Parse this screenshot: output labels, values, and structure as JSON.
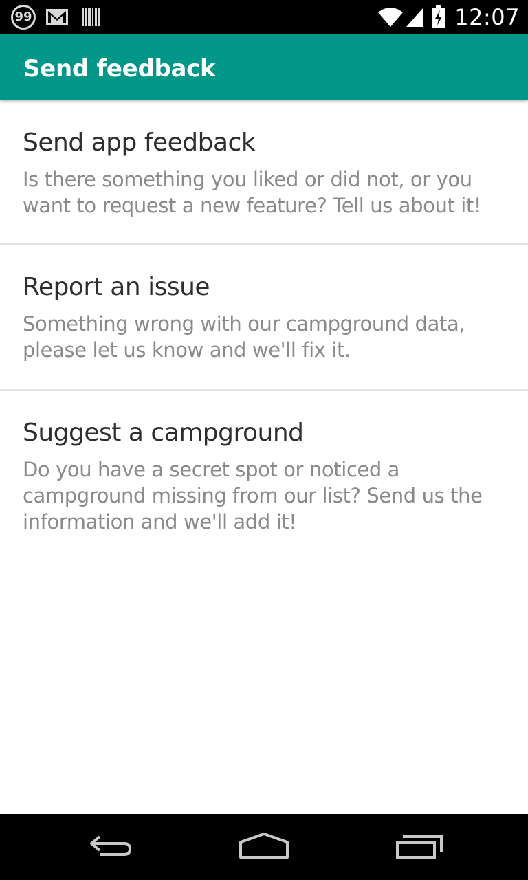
{
  "status_bar": {
    "notification_count": "99",
    "time": "12:07",
    "icons": [
      "notification-count-icon",
      "gmail-icon",
      "barcode-icon",
      "wifi-icon",
      "signal-icon",
      "battery-charging-icon"
    ]
  },
  "app_bar": {
    "title": "Send feedback",
    "color": "#009688"
  },
  "items": [
    {
      "title": "Send app feedback",
      "description": "Is there something you liked or did not, or you want to request a new feature? Tell us about it!"
    },
    {
      "title": "Report an issue",
      "description": "Something wrong with our campground data, please let us know and we'll fix it."
    },
    {
      "title": "Suggest a campground",
      "description": "Do you have a secret spot or noticed a campground missing from our list? Send us the information and we'll add it!"
    }
  ],
  "nav_bar": {
    "buttons": [
      "back-icon",
      "home-icon",
      "recents-icon"
    ]
  }
}
